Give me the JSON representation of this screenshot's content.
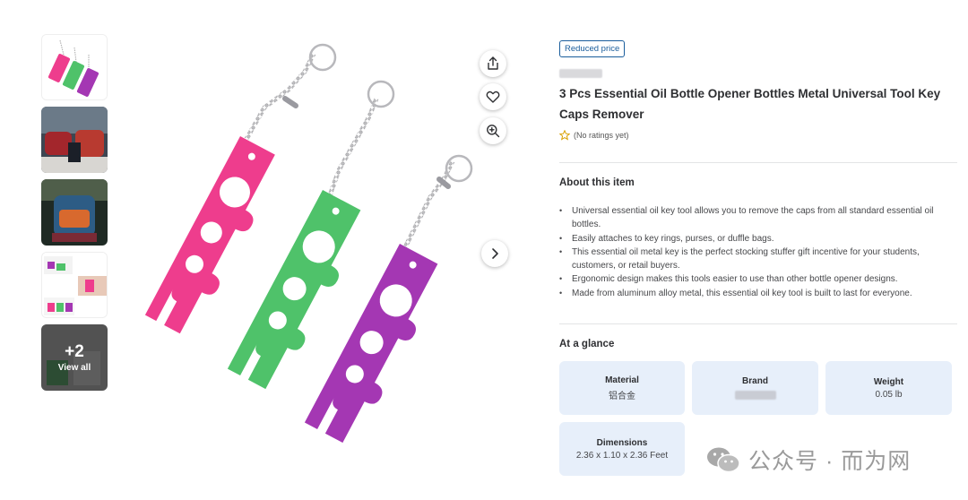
{
  "gallery": {
    "view_all_count": "+2",
    "view_all_label": "View all",
    "thumbnails": [
      "thumb-1",
      "thumb-2",
      "thumb-3",
      "thumb-4",
      "thumb-5"
    ]
  },
  "actions": {
    "share_icon": "share-icon",
    "favorite_icon": "heart-icon",
    "zoom_icon": "zoom-in-icon",
    "next_icon": "chevron-right-icon"
  },
  "product": {
    "badge": "Reduced price",
    "title": "3 Pcs Essential Oil Bottle Opener Bottles Metal Universal Tool Key Caps Remover",
    "rating_text": "(No ratings yet)",
    "colors": {
      "pink": "#ee3d8d",
      "green": "#4fc26a",
      "purple": "#a437b3",
      "accent": "#1a5d9c"
    }
  },
  "about": {
    "heading": "About this item",
    "bullets": [
      "Universal essential oil key tool allows you to remove the caps from all standard essential oil bottles.",
      "Easily attaches to key rings, purses, or duffle bags.",
      "This essential oil metal key is the perfect stocking stuffer gift incentive for your students, customers, or retail buyers.",
      "Ergonomic design makes this tools easier to use than other bottle opener designs.",
      "Made from aluminum alloy metal, this essential oil key tool is built to last for everyone."
    ]
  },
  "glance": {
    "heading": "At a glance",
    "material_label": "Material",
    "material_value": "铝合金",
    "brand_label": "Brand",
    "weight_label": "Weight",
    "weight_value": "0.05 lb",
    "dimensions_label": "Dimensions",
    "dimensions_value": "2.36 x 1.10 x 2.36 Feet"
  },
  "watermark": {
    "text": "公众号 · 而为网"
  }
}
